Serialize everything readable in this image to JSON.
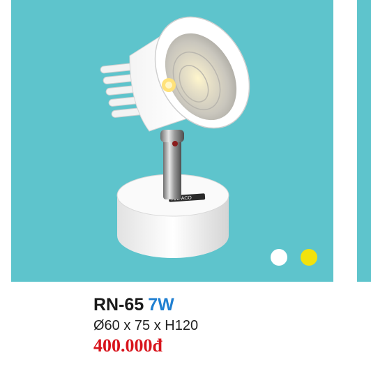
{
  "product": {
    "model": "RN-65",
    "power": "7W",
    "dimensions": "Ø60 x 75 x H120",
    "price": "400.000đ"
  },
  "logo_text": "ANFACO",
  "color_options": [
    {
      "name": "white",
      "color": "#ffffff"
    },
    {
      "name": "yellow",
      "color": "#f2e20c"
    }
  ],
  "colors": {
    "background": "#5ec4cc",
    "power_accent": "#1f7fd1",
    "price": "#d8141c"
  }
}
